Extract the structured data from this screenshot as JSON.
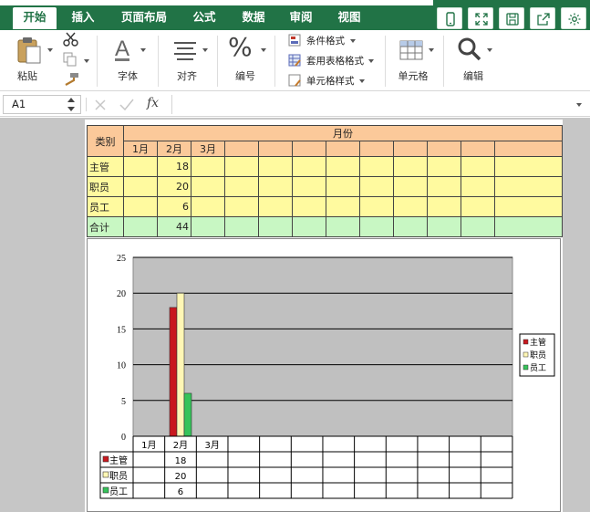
{
  "ribbon": {
    "tabs": [
      {
        "label": "开始",
        "active": true
      },
      {
        "label": "插入",
        "active": false
      },
      {
        "label": "页面布局",
        "active": false
      },
      {
        "label": "公式",
        "active": false
      },
      {
        "label": "数据",
        "active": false
      },
      {
        "label": "审阅",
        "active": false
      },
      {
        "label": "视图",
        "active": false
      }
    ],
    "groups": {
      "paste_label": "粘贴",
      "font_label": "字体",
      "align_label": "对齐",
      "number_label": "编号",
      "number_symbol": "%",
      "conditional_format_label": "条件格式",
      "table_format_label": "套用表格格式",
      "cell_style_label": "单元格样式",
      "cells_label": "单元格",
      "edit_label": "编辑"
    },
    "right_icons": [
      "phone-icon",
      "fullscreen-icon",
      "save-icon",
      "share-icon",
      "settings-icon"
    ],
    "accent_color": "#217346"
  },
  "formula_bar": {
    "name_box": "A1",
    "fx_label": "fx",
    "formula": ""
  },
  "sheet": {
    "header_category": "类别",
    "header_month": "月份",
    "months": [
      "1月",
      "2月",
      "3月"
    ],
    "rows": [
      {
        "label": "主管",
        "values": [
          "",
          "18",
          ""
        ]
      },
      {
        "label": "职员",
        "values": [
          "",
          "20",
          ""
        ]
      },
      {
        "label": "员工",
        "values": [
          "",
          "6",
          ""
        ]
      }
    ],
    "total": {
      "label": "合计",
      "values": [
        "",
        "44",
        ""
      ]
    }
  },
  "chart_data": {
    "type": "bar",
    "categories": [
      "1月",
      "2月",
      "3月"
    ],
    "series": [
      {
        "name": "主管",
        "values": [
          0,
          18,
          0
        ],
        "color": "#c8181e"
      },
      {
        "name": "职员",
        "values": [
          0,
          20,
          0
        ],
        "color": "#fff7b5"
      },
      {
        "name": "员工",
        "values": [
          0,
          6,
          0
        ],
        "color": "#36c35a"
      }
    ],
    "ylim": [
      0,
      25
    ],
    "yticks": [
      "0",
      "5",
      "10",
      "15",
      "20",
      "25"
    ],
    "grid": true,
    "legend": "right",
    "plot_background": "#c0c0c0",
    "data_table": true
  }
}
